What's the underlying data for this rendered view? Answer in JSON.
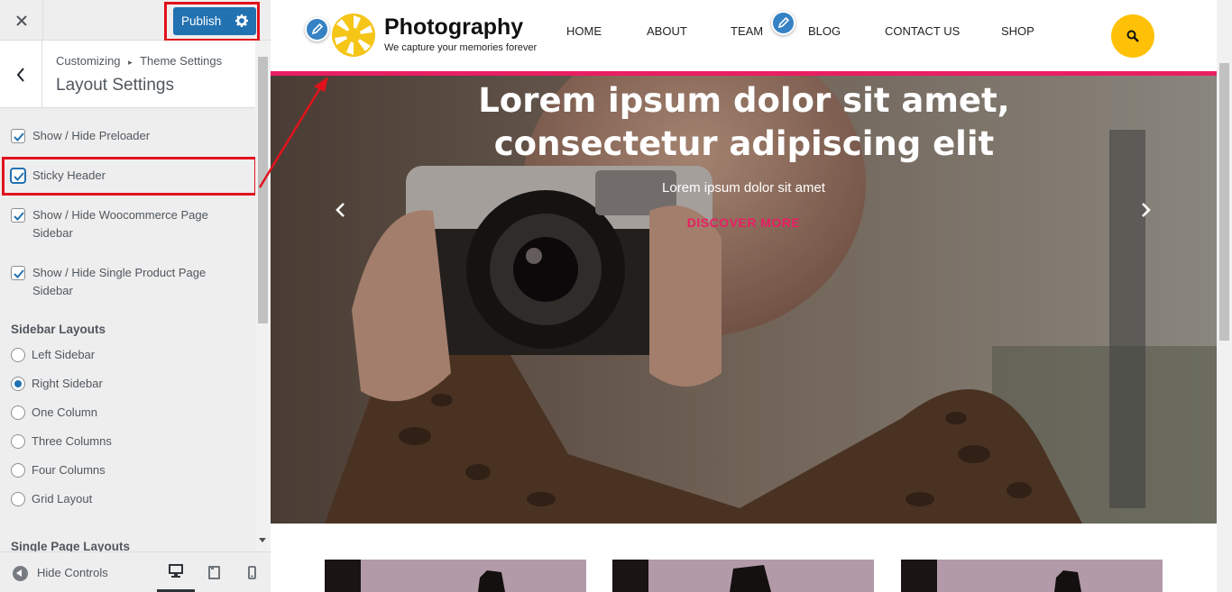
{
  "customizer": {
    "close_icon": "close-icon",
    "publish_label": "Publish",
    "breadcrumb_root": "Customizing",
    "breadcrumb_sep": "▸",
    "breadcrumb_parent": "Theme Settings",
    "section_title": "Layout Settings",
    "checkboxes": [
      {
        "label": "Show / Hide Preloader",
        "checked": true
      },
      {
        "label": "Sticky Header",
        "checked": true
      },
      {
        "label_line1": "Show / Hide Woocommerce Page",
        "label_line2": "Sidebar",
        "checked": true
      },
      {
        "label_line1": "Show / Hide Single Product Page",
        "label_line2": "Sidebar",
        "checked": true
      }
    ],
    "sidebar_layouts_title": "Sidebar Layouts",
    "sidebar_layouts": [
      {
        "label": "Left Sidebar",
        "selected": false
      },
      {
        "label": "Right Sidebar",
        "selected": true
      },
      {
        "label": "One Column",
        "selected": false
      },
      {
        "label": "Three Columns",
        "selected": false
      },
      {
        "label": "Four Columns",
        "selected": false
      },
      {
        "label": "Grid Layout",
        "selected": false
      }
    ],
    "single_page_layouts_title": "Single Page Layouts",
    "hide_controls_label": "Hide Controls",
    "devices": [
      "desktop",
      "tablet",
      "mobile"
    ],
    "active_device": "desktop"
  },
  "site": {
    "title": "Photography",
    "tagline": "We capture your memories forever",
    "nav": [
      "HOME",
      "ABOUT",
      "TEAM",
      "BLOG",
      "CONTACT US",
      "SHOP"
    ],
    "hero_title_line1": "Lorem ipsum dolor sit amet,",
    "hero_title_line2": "consectetur adipiscing elit",
    "hero_subtitle": "Lorem ipsum dolor sit amet",
    "hero_cta": "DISCOVER MORE"
  },
  "colors": {
    "publish_blue": "#2271b1",
    "highlight_red": "#e1121d",
    "accent_pink": "#e91e63",
    "search_yellow": "#ffc107",
    "logo_yellow": "#f5c518"
  }
}
